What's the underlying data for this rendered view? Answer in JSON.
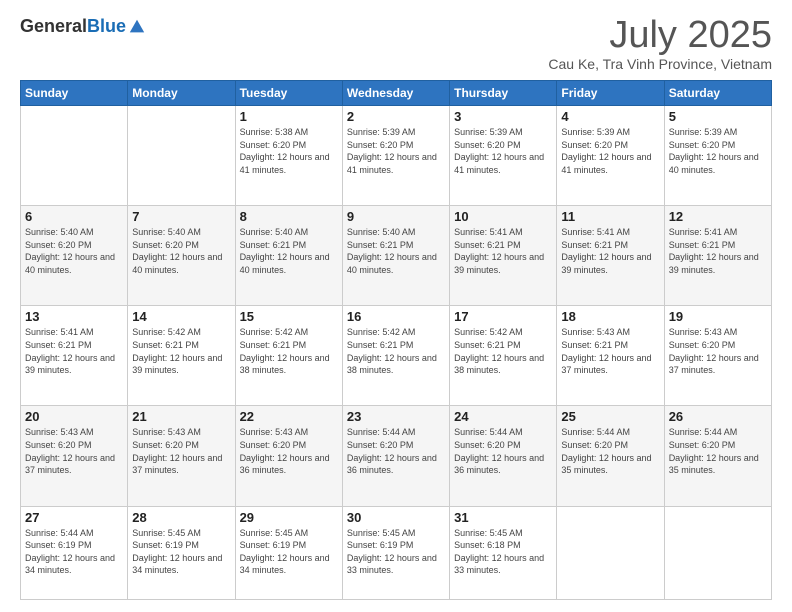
{
  "logo": {
    "general": "General",
    "blue": "Blue"
  },
  "title": "July 2025",
  "subtitle": "Cau Ke, Tra Vinh Province, Vietnam",
  "days_of_week": [
    "Sunday",
    "Monday",
    "Tuesday",
    "Wednesday",
    "Thursday",
    "Friday",
    "Saturday"
  ],
  "weeks": [
    [
      {
        "day": "",
        "info": ""
      },
      {
        "day": "",
        "info": ""
      },
      {
        "day": "1",
        "info": "Sunrise: 5:38 AM\nSunset: 6:20 PM\nDaylight: 12 hours and 41 minutes."
      },
      {
        "day": "2",
        "info": "Sunrise: 5:39 AM\nSunset: 6:20 PM\nDaylight: 12 hours and 41 minutes."
      },
      {
        "day": "3",
        "info": "Sunrise: 5:39 AM\nSunset: 6:20 PM\nDaylight: 12 hours and 41 minutes."
      },
      {
        "day": "4",
        "info": "Sunrise: 5:39 AM\nSunset: 6:20 PM\nDaylight: 12 hours and 41 minutes."
      },
      {
        "day": "5",
        "info": "Sunrise: 5:39 AM\nSunset: 6:20 PM\nDaylight: 12 hours and 40 minutes."
      }
    ],
    [
      {
        "day": "6",
        "info": "Sunrise: 5:40 AM\nSunset: 6:20 PM\nDaylight: 12 hours and 40 minutes."
      },
      {
        "day": "7",
        "info": "Sunrise: 5:40 AM\nSunset: 6:20 PM\nDaylight: 12 hours and 40 minutes."
      },
      {
        "day": "8",
        "info": "Sunrise: 5:40 AM\nSunset: 6:21 PM\nDaylight: 12 hours and 40 minutes."
      },
      {
        "day": "9",
        "info": "Sunrise: 5:40 AM\nSunset: 6:21 PM\nDaylight: 12 hours and 40 minutes."
      },
      {
        "day": "10",
        "info": "Sunrise: 5:41 AM\nSunset: 6:21 PM\nDaylight: 12 hours and 39 minutes."
      },
      {
        "day": "11",
        "info": "Sunrise: 5:41 AM\nSunset: 6:21 PM\nDaylight: 12 hours and 39 minutes."
      },
      {
        "day": "12",
        "info": "Sunrise: 5:41 AM\nSunset: 6:21 PM\nDaylight: 12 hours and 39 minutes."
      }
    ],
    [
      {
        "day": "13",
        "info": "Sunrise: 5:41 AM\nSunset: 6:21 PM\nDaylight: 12 hours and 39 minutes."
      },
      {
        "day": "14",
        "info": "Sunrise: 5:42 AM\nSunset: 6:21 PM\nDaylight: 12 hours and 39 minutes."
      },
      {
        "day": "15",
        "info": "Sunrise: 5:42 AM\nSunset: 6:21 PM\nDaylight: 12 hours and 38 minutes."
      },
      {
        "day": "16",
        "info": "Sunrise: 5:42 AM\nSunset: 6:21 PM\nDaylight: 12 hours and 38 minutes."
      },
      {
        "day": "17",
        "info": "Sunrise: 5:42 AM\nSunset: 6:21 PM\nDaylight: 12 hours and 38 minutes."
      },
      {
        "day": "18",
        "info": "Sunrise: 5:43 AM\nSunset: 6:21 PM\nDaylight: 12 hours and 37 minutes."
      },
      {
        "day": "19",
        "info": "Sunrise: 5:43 AM\nSunset: 6:20 PM\nDaylight: 12 hours and 37 minutes."
      }
    ],
    [
      {
        "day": "20",
        "info": "Sunrise: 5:43 AM\nSunset: 6:20 PM\nDaylight: 12 hours and 37 minutes."
      },
      {
        "day": "21",
        "info": "Sunrise: 5:43 AM\nSunset: 6:20 PM\nDaylight: 12 hours and 37 minutes."
      },
      {
        "day": "22",
        "info": "Sunrise: 5:43 AM\nSunset: 6:20 PM\nDaylight: 12 hours and 36 minutes."
      },
      {
        "day": "23",
        "info": "Sunrise: 5:44 AM\nSunset: 6:20 PM\nDaylight: 12 hours and 36 minutes."
      },
      {
        "day": "24",
        "info": "Sunrise: 5:44 AM\nSunset: 6:20 PM\nDaylight: 12 hours and 36 minutes."
      },
      {
        "day": "25",
        "info": "Sunrise: 5:44 AM\nSunset: 6:20 PM\nDaylight: 12 hours and 35 minutes."
      },
      {
        "day": "26",
        "info": "Sunrise: 5:44 AM\nSunset: 6:20 PM\nDaylight: 12 hours and 35 minutes."
      }
    ],
    [
      {
        "day": "27",
        "info": "Sunrise: 5:44 AM\nSunset: 6:19 PM\nDaylight: 12 hours and 34 minutes."
      },
      {
        "day": "28",
        "info": "Sunrise: 5:45 AM\nSunset: 6:19 PM\nDaylight: 12 hours and 34 minutes."
      },
      {
        "day": "29",
        "info": "Sunrise: 5:45 AM\nSunset: 6:19 PM\nDaylight: 12 hours and 34 minutes."
      },
      {
        "day": "30",
        "info": "Sunrise: 5:45 AM\nSunset: 6:19 PM\nDaylight: 12 hours and 33 minutes."
      },
      {
        "day": "31",
        "info": "Sunrise: 5:45 AM\nSunset: 6:18 PM\nDaylight: 12 hours and 33 minutes."
      },
      {
        "day": "",
        "info": ""
      },
      {
        "day": "",
        "info": ""
      }
    ]
  ]
}
